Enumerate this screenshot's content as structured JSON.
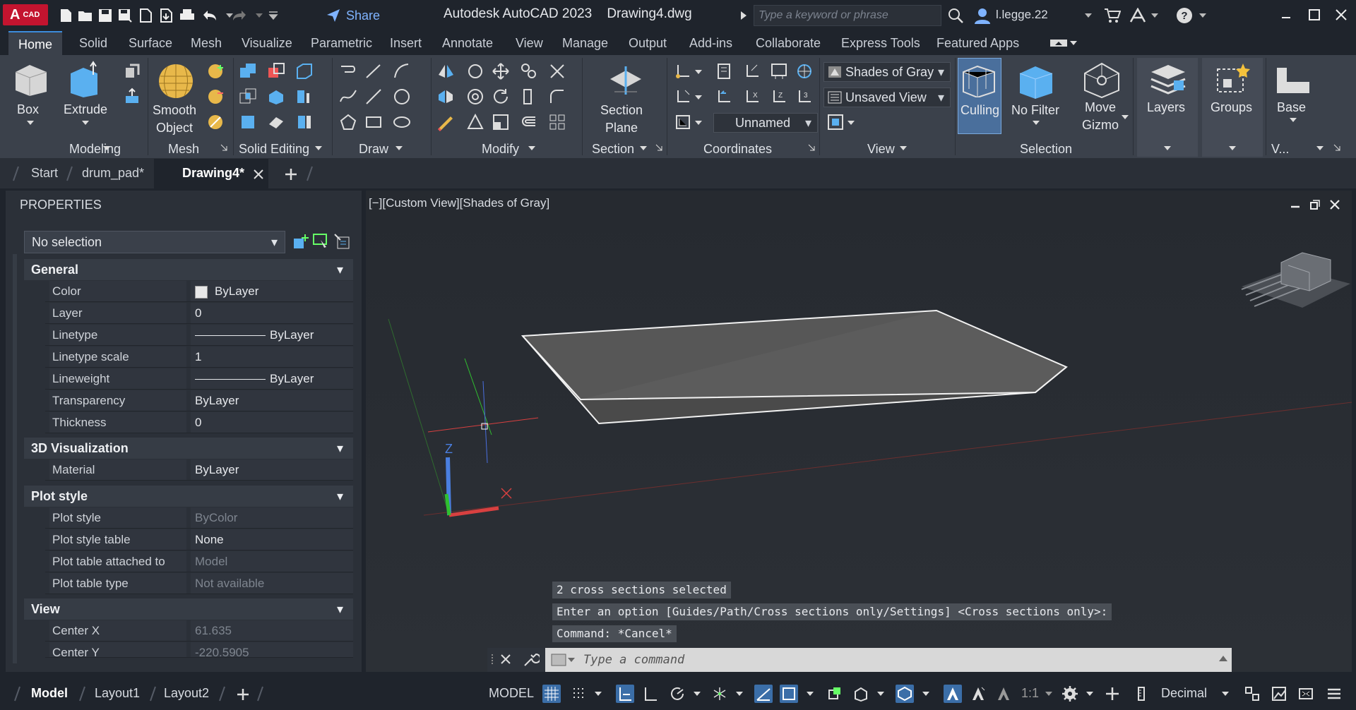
{
  "titlebar": {
    "logo_text": "A",
    "logo_sub": "CAD",
    "share_label": "Share",
    "app_title": "Autodesk AutoCAD 2023",
    "doc_title": "Drawing4.dwg",
    "search_placeholder": "Type a keyword or phrase",
    "user_name": "l.legge.22"
  },
  "ribbon_tabs": [
    "Home",
    "Solid",
    "Surface",
    "Mesh",
    "Visualize",
    "Parametric",
    "Insert",
    "Annotate",
    "View",
    "Manage",
    "Output",
    "Add-ins",
    "Collaborate",
    "Express Tools",
    "Featured Apps"
  ],
  "ribbon": {
    "box_label": "Box",
    "extrude_label": "Extrude",
    "smooth_label_1": "Smooth",
    "smooth_label_2": "Object",
    "section_label_1": "Section",
    "section_label_2": "Plane",
    "culling_label": "Culling",
    "nofilter_label": "No Filter",
    "gizmo_label_1": "Move",
    "gizmo_label_2": "Gizmo",
    "layers_label": "Layers",
    "groups_label": "Groups",
    "base_label": "Base",
    "visual_style": "Shades of Gray",
    "view_name": "Unsaved View",
    "ucs_name": "Unnamed",
    "panels": {
      "modeling": "Modeling",
      "mesh": "Mesh",
      "solid_editing": "Solid Editing",
      "draw": "Draw",
      "modify": "Modify",
      "section": "Section",
      "coordinates": "Coordinates",
      "view": "View",
      "selection": "Selection",
      "v": "V..."
    }
  },
  "doc_tabs": {
    "start": "Start",
    "drum_pad": "drum_pad*",
    "drawing4": "Drawing4*"
  },
  "properties": {
    "title": "PROPERTIES",
    "selection": "No selection",
    "general": {
      "header": "General",
      "color_k": "Color",
      "color_v": "ByLayer",
      "layer_k": "Layer",
      "layer_v": "0",
      "linetype_k": "Linetype",
      "linetype_v": "ByLayer",
      "ltscale_k": "Linetype scale",
      "ltscale_v": "1",
      "lineweight_k": "Lineweight",
      "lineweight_v": "ByLayer",
      "transparency_k": "Transparency",
      "transparency_v": "ByLayer",
      "thickness_k": "Thickness",
      "thickness_v": "0"
    },
    "viz": {
      "header": "3D Visualization",
      "material_k": "Material",
      "material_v": "ByLayer"
    },
    "plot": {
      "header": "Plot style",
      "style_k": "Plot style",
      "style_v": "ByColor",
      "table_k": "Plot style table",
      "table_v": "None",
      "attached_k": "Plot table attached to",
      "attached_v": "Model",
      "type_k": "Plot table type",
      "type_v": "Not available"
    },
    "view": {
      "header": "View",
      "cx_k": "Center X",
      "cx_v": "61.635",
      "cy_k": "Center Y",
      "cy_v": "-220.5905"
    }
  },
  "viewport": {
    "label": "[−][Custom View][Shades of Gray]",
    "axis_z": "Z",
    "cmd_history": [
      "2 cross sections selected",
      "Enter an option [Guides/Path/Cross sections only/Settings] <Cross sections only>:",
      "Command: *Cancel*"
    ],
    "cmd_placeholder": "Type a command"
  },
  "statusbar": {
    "model_tab": "Model",
    "layout1": "Layout1",
    "layout2": "Layout2",
    "model_btn": "MODEL",
    "scale": "1:1",
    "units": "Decimal"
  }
}
